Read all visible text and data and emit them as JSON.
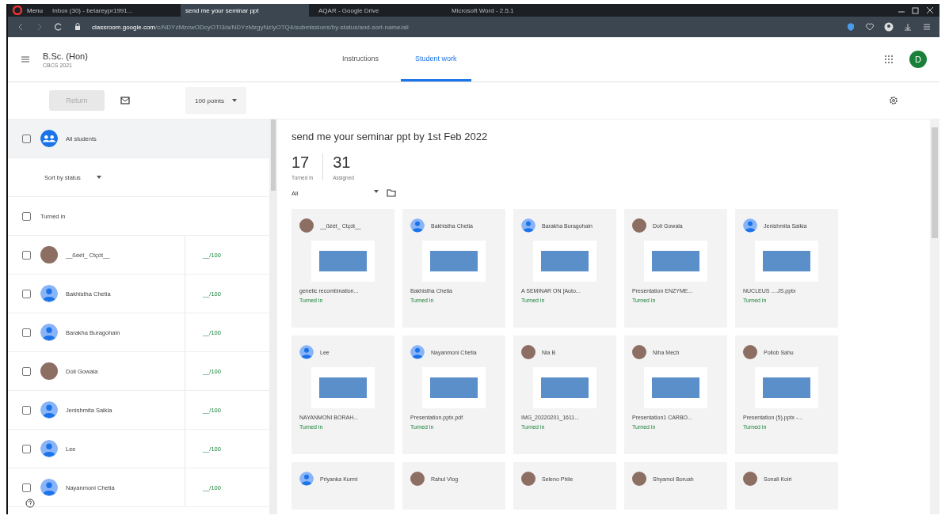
{
  "browser": {
    "menu": "Menu",
    "tabs": [
      {
        "title": "Inbox (30) - betareypr1991...",
        "selected": false
      },
      {
        "title": "send me your seminar ppt",
        "selected": true
      },
      {
        "title": "AQAR - Google Drive",
        "selected": false
      },
      {
        "title": "Microsoft Word - 2.5.1",
        "selected": false
      }
    ],
    "url_host": "classroom.google.com",
    "url_path": "/c/NDYzMzcwODcyOTI3/a/NDYzMzgyNzIyOTQ4/submissions/by-status/and-sort-name/all"
  },
  "header": {
    "class_name": "B.Sc. (Hon)",
    "section": "CBCS 2021",
    "avatar_letter": "D",
    "tabs": [
      {
        "label": "Instructions",
        "selected": false
      },
      {
        "label": "Student work",
        "selected": true
      }
    ]
  },
  "toolbar": {
    "return_button": "Return",
    "return_disabled": true,
    "points": "100 points"
  },
  "roster": {
    "all_students": "All students",
    "all_checked": false,
    "sort": "Sort by status",
    "section": "Turned in",
    "section_checked": false,
    "students": [
      {
        "name": "__ßéét_ Ctçót__",
        "kind": "photo",
        "grade": "__/100",
        "checked": false
      },
      {
        "name": "Bakhistha Chetia",
        "kind": "default",
        "grade": "__/100",
        "checked": false
      },
      {
        "name": "Barakha Buragohain",
        "kind": "default",
        "grade": "__/100",
        "checked": false
      },
      {
        "name": "Doli Gowala",
        "kind": "photo",
        "grade": "__/100",
        "checked": false
      },
      {
        "name": "Jenishmita Saikia",
        "kind": "default",
        "grade": "__/100",
        "checked": false
      },
      {
        "name": "Lee",
        "kind": "default",
        "grade": "__/100",
        "checked": false
      },
      {
        "name": "Nayanmoni Chetia",
        "kind": "default",
        "grade": "__/100",
        "checked": false
      }
    ]
  },
  "work": {
    "title": "send me your seminar ppt by 1st Feb 2022",
    "turned_in_count": "17",
    "turned_in_label": "Turned in",
    "assigned_count": "31",
    "assigned_label": "Assigned",
    "filter": "All",
    "cards": [
      {
        "name": "__ßéét_ Ctçót__",
        "kind": "photo",
        "file": "genetic recombination...",
        "status": "Turned in"
      },
      {
        "name": "Bakhistha Chetia",
        "kind": "default",
        "file": "Bakhistha Chetia",
        "status": "Turned in"
      },
      {
        "name": "Barakha Buragohain",
        "kind": "default",
        "file": "A SEMINAR ON [Auto...",
        "status": "Turned in"
      },
      {
        "name": "Doli Gowala",
        "kind": "photo",
        "file": "Presentation ENZYME...",
        "status": "Turned in"
      },
      {
        "name": "Jenishmita Saikia",
        "kind": "default",
        "file": "NUCLEUS ....JS.pptx",
        "status": "Turned in"
      },
      {
        "name": "Lee",
        "kind": "default",
        "file": "NAYANMONI BORAH...",
        "status": "Turned in"
      },
      {
        "name": "Nayanmoni Chetia",
        "kind": "default",
        "file": "Presentation.pptx.pdf",
        "status": "Turned in"
      },
      {
        "name": "Nia B",
        "kind": "photo",
        "file": "IMG_20220201_1611...",
        "status": "Turned in"
      },
      {
        "name": "Niha Mech",
        "kind": "photo",
        "file": "Presentation1 CARBO...",
        "status": "Turned in"
      },
      {
        "name": "Pollob Sahu",
        "kind": "photo",
        "file": "Presentation (5).pptx -...",
        "status": "Turned in"
      },
      {
        "name": "Priyanka Kurmi",
        "kind": "default"
      },
      {
        "name": "Rahul Vlog",
        "kind": "photo"
      },
      {
        "name": "Seleno Phile",
        "kind": "photo"
      },
      {
        "name": "Shyamol Boruah",
        "kind": "photo"
      },
      {
        "name": "Sonali Koiri",
        "kind": "photo"
      }
    ]
  }
}
